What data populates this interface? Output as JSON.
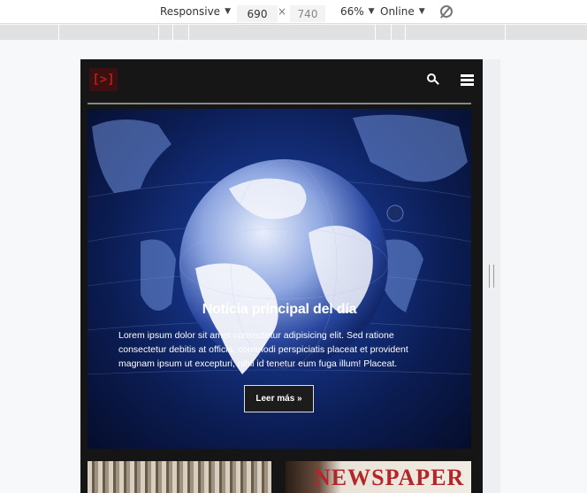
{
  "devtools": {
    "device": "Responsive",
    "width": "690",
    "separator": "×",
    "height": "740",
    "zoom": "66%",
    "network": "Online"
  },
  "site": {
    "logo_text": "[>]",
    "hero": {
      "title": "Noticia principal del día",
      "body": "Lorem ipsum dolor sit amet consectetur adipisicing elit. Sed ratione consectetur debitis at officia, commodi perspiciatis placeat et provident magnam ipsum ut excepturi, nihil id tenetur eum fuga illum! Placeat.",
      "button": "Leer más »"
    },
    "thumb_2_text": "NEWSPAPER"
  },
  "colors": {
    "page_bg": "#151515",
    "hero_blue": "#14307e",
    "logo_red": "#b0201c"
  }
}
